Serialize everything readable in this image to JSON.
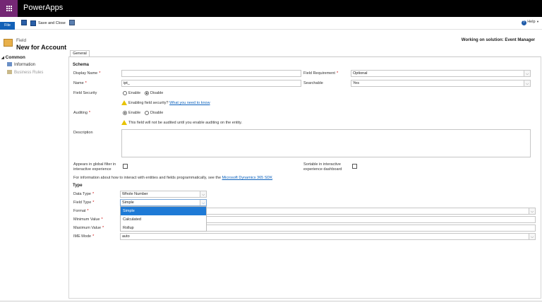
{
  "app": {
    "name": "PowerApps"
  },
  "ribbon": {
    "file_label": "File",
    "save_close_label": "Save and Close",
    "help_label": "Help"
  },
  "header": {
    "entity_label": "Field",
    "title": "New for Account",
    "solution": "Working on solution: Event Manager"
  },
  "nav": {
    "section": "Common",
    "items": [
      {
        "label": "Information",
        "active": true
      },
      {
        "label": "Business Rules",
        "active": false
      }
    ]
  },
  "tabs": [
    {
      "label": "General"
    }
  ],
  "schema": {
    "heading": "Schema",
    "display_name": {
      "label": "Display Name",
      "value": ""
    },
    "name": {
      "label": "Name",
      "value": "ipt_"
    },
    "field_requirement": {
      "label": "Field Requirement",
      "value": "Optional"
    },
    "searchable": {
      "label": "Searchable",
      "value": "Yes"
    },
    "field_security": {
      "label": "Field Security",
      "options": [
        "Enable",
        "Disable"
      ],
      "selected": "Disable"
    },
    "field_security_warning": "Enabling field security?",
    "field_security_link": "What you need to know",
    "auditing": {
      "label": "Auditing",
      "options": [
        "Enable",
        "Disable"
      ],
      "selected": "Enable"
    },
    "auditing_warning": "This field will not be audited until you enable auditing on the entity.",
    "description": {
      "label": "Description",
      "value": ""
    },
    "global_filter": {
      "label_line1": "Appears in global filter in",
      "label_line2": "interactive experience",
      "checked": false
    },
    "sortable": {
      "label_line1": "Sortable in interactive",
      "label_line2": "experience dashboard",
      "checked": false
    },
    "info_text": "For information about how to interact with entities and fields programmatically, see the",
    "info_link": "Microsoft Dynamics 365 SDK"
  },
  "type": {
    "heading": "Type",
    "data_type": {
      "label": "Data Type",
      "value": "Whole Number"
    },
    "field_type": {
      "label": "Field Type",
      "value": "Simple",
      "options": [
        "Simple",
        "Calculated",
        "Rollup"
      ],
      "highlighted": "Simple"
    },
    "format": {
      "label": "Format",
      "value": ""
    },
    "minimum_value": {
      "label": "Minimum Value",
      "value": ""
    },
    "maximum_value": {
      "label": "Maximum Value",
      "value": ""
    },
    "ime_mode": {
      "label": "IME Mode",
      "value": "auto"
    }
  },
  "colors": {
    "brand": "#742774",
    "topbar": "#000000",
    "file": "#1160b7",
    "highlight": "#1e7ad6",
    "required": "#cc0000",
    "link": "#0b61bd"
  }
}
